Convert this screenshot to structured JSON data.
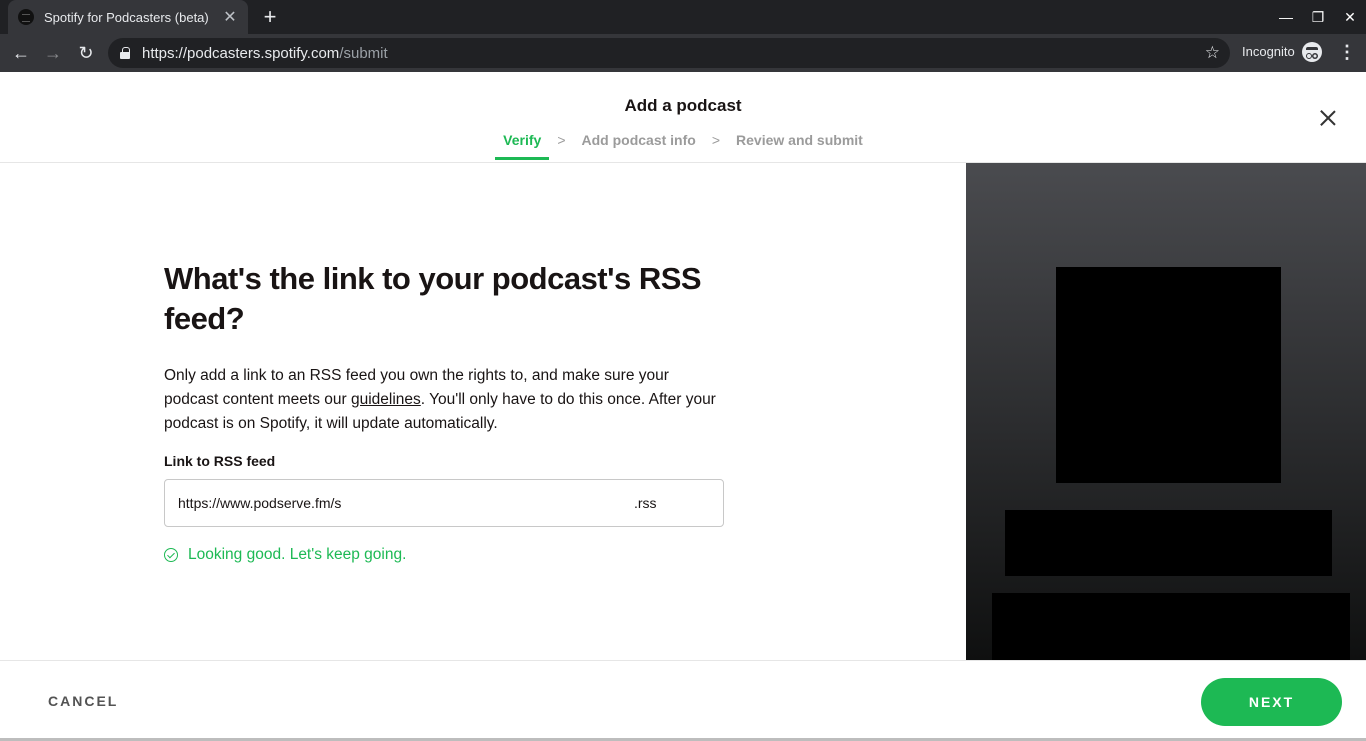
{
  "browser": {
    "tab_title": "Spotify for Podcasters (beta)",
    "tab_close_glyph": "✕",
    "new_tab_glyph": "+",
    "url_main": "https://podcasters.spotify.com",
    "url_path": "/submit",
    "incognito_label": "Incognito",
    "back_glyph": "←",
    "forward_glyph": "→",
    "reload_glyph": "↻",
    "star_glyph": "☆",
    "menu_glyph": "⋮",
    "minimize_glyph": "—",
    "restore_glyph": "❐",
    "close_glyph": "✕"
  },
  "header": {
    "title": "Add a podcast",
    "steps": [
      {
        "label": "Verify",
        "active": true
      },
      {
        "label": "Add podcast info",
        "active": false
      },
      {
        "label": "Review and submit",
        "active": false
      }
    ],
    "chevron": ">"
  },
  "main": {
    "heading": "What's the link to your podcast's RSS feed?",
    "desc_before": "Only add a link to an RSS feed you own the rights to, and make sure your podcast content meets our ",
    "desc_link": "guidelines",
    "desc_after": ". You'll only have to do this once. After your podcast is on Spotify, it will update automatically.",
    "field_label": "Link to RSS feed",
    "field_value": "https://www.podserve.fm/s",
    "field_suffix": ".rss",
    "success_message": "Looking good. Let's keep going."
  },
  "footer": {
    "cancel_label": "CANCEL",
    "next_label": "NEXT"
  },
  "colors": {
    "accent": "#1db954",
    "text": "#191414",
    "muted": "#9b9b9b"
  }
}
